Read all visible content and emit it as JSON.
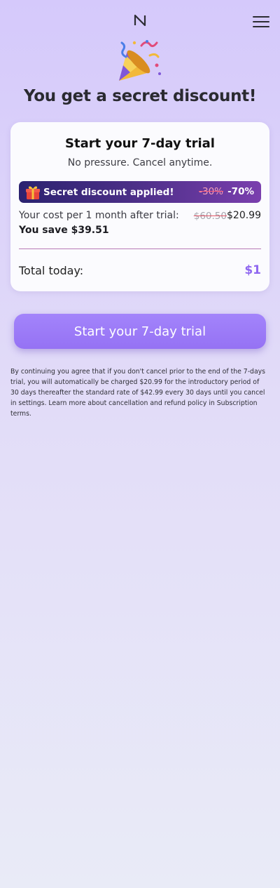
{
  "header": {
    "logo_icon": "brand-logo-icon",
    "menu_icon": "hamburger-menu-icon"
  },
  "hero": {
    "icon": "party-popper-icon",
    "headline": "You get a secret discount!"
  },
  "card": {
    "title": "Start your 7-day trial",
    "subtitle": "No pressure. Cancel anytime.",
    "banner": {
      "icon": "gift-icon",
      "label": "Secret discount applied!",
      "old_discount": "-30%",
      "new_discount": "-70%"
    },
    "cost_label": "Your cost per 1 month after trial:",
    "cost_old": "$60.50",
    "cost_new": "$20.99",
    "savings": "You save $39.51",
    "total_label": "Total today:",
    "total_value": "$1"
  },
  "cta": {
    "label": "Start your 7-day trial"
  },
  "legal": "By continuing you agree that if you don't cancel prior to the end of the 7-days trial, you will automatically be charged $20.99 for the introductory period of 30 days thereafter the standard rate of $42.99 every 30 days until you cancel in settings. Learn more about cancellation and refund policy in Subscription terms.",
  "colors": {
    "accent": "#9572f4",
    "total_value": "#8f67f0",
    "banner_start": "#2b2270",
    "banner_end": "#7a3fae",
    "background_top": "#d5c9fb",
    "background_bottom": "#e9ebf7"
  }
}
